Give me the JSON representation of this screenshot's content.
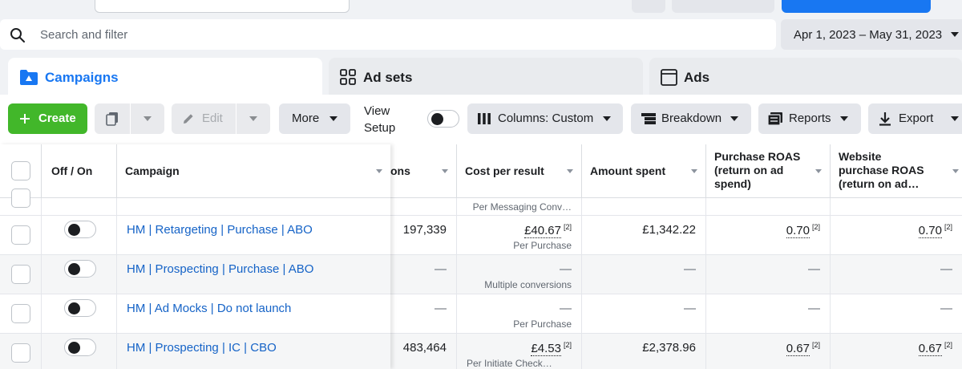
{
  "search": {
    "placeholder": "Search and filter"
  },
  "date_range": {
    "label": "Apr 1, 2023 – May 31, 2023"
  },
  "tabs": [
    {
      "label": "Campaigns",
      "icon": "folder-icon",
      "active": true
    },
    {
      "label": "Ad sets",
      "icon": "grid-icon",
      "active": false
    },
    {
      "label": "Ads",
      "icon": "ad-square-icon",
      "active": false
    }
  ],
  "toolbar": {
    "create_label": "Create",
    "edit_label": "Edit",
    "more_label": "More",
    "view_setup_line1": "View",
    "view_setup_line2": "Setup",
    "columns_label": "Columns: Custom",
    "breakdown_label": "Breakdown",
    "reports_label": "Reports",
    "export_label": "Export"
  },
  "columns": {
    "off_on": "Off / On",
    "campaign": "Campaign",
    "results_partial": "ons",
    "cost_per_result": "Cost per result",
    "amount_spent": "Amount spent",
    "purchase_roas": [
      "Purchase ROAS",
      "(return on ad",
      "spend)"
    ],
    "website_roas": [
      "Website",
      "purchase ROAS",
      "(return on ad…"
    ]
  },
  "partial_row": {
    "cost_sub": "Per Messaging Conv…"
  },
  "rows": [
    {
      "name": "HM | Retargeting | Purchase | ABO",
      "results": "197,339",
      "cost": "£40.67",
      "cost_ref": "[2]",
      "cost_sub": "Per Purchase",
      "spent": "£1,342.22",
      "roas": "0.70",
      "roas_ref": "[2]",
      "web_roas": "0.70",
      "web_roas_ref": "[2]"
    },
    {
      "name": "HM | Prospecting | Purchase | ABO",
      "results": "—",
      "cost": "—",
      "cost_sub": "Multiple conversions",
      "spent": "—",
      "roas": "—",
      "web_roas": "—"
    },
    {
      "name": "HM | Ad Mocks | Do not launch",
      "results": "—",
      "cost": "—",
      "cost_sub": "Per Purchase",
      "spent": "—",
      "roas": "—",
      "web_roas": "—"
    },
    {
      "name": "HM | Prospecting | IC | CBO",
      "results": "483,464",
      "cost": "£4.53",
      "cost_ref": "[2]",
      "cost_sub": "Per Initiate Check…",
      "spent": "£2,378.96",
      "roas": "0.67",
      "roas_ref": "[2]",
      "web_roas": "0.67",
      "web_roas_ref": "[2]"
    }
  ],
  "colors": {
    "accent": "#1877f2",
    "create": "#42b72a",
    "link": "#1563c7"
  }
}
